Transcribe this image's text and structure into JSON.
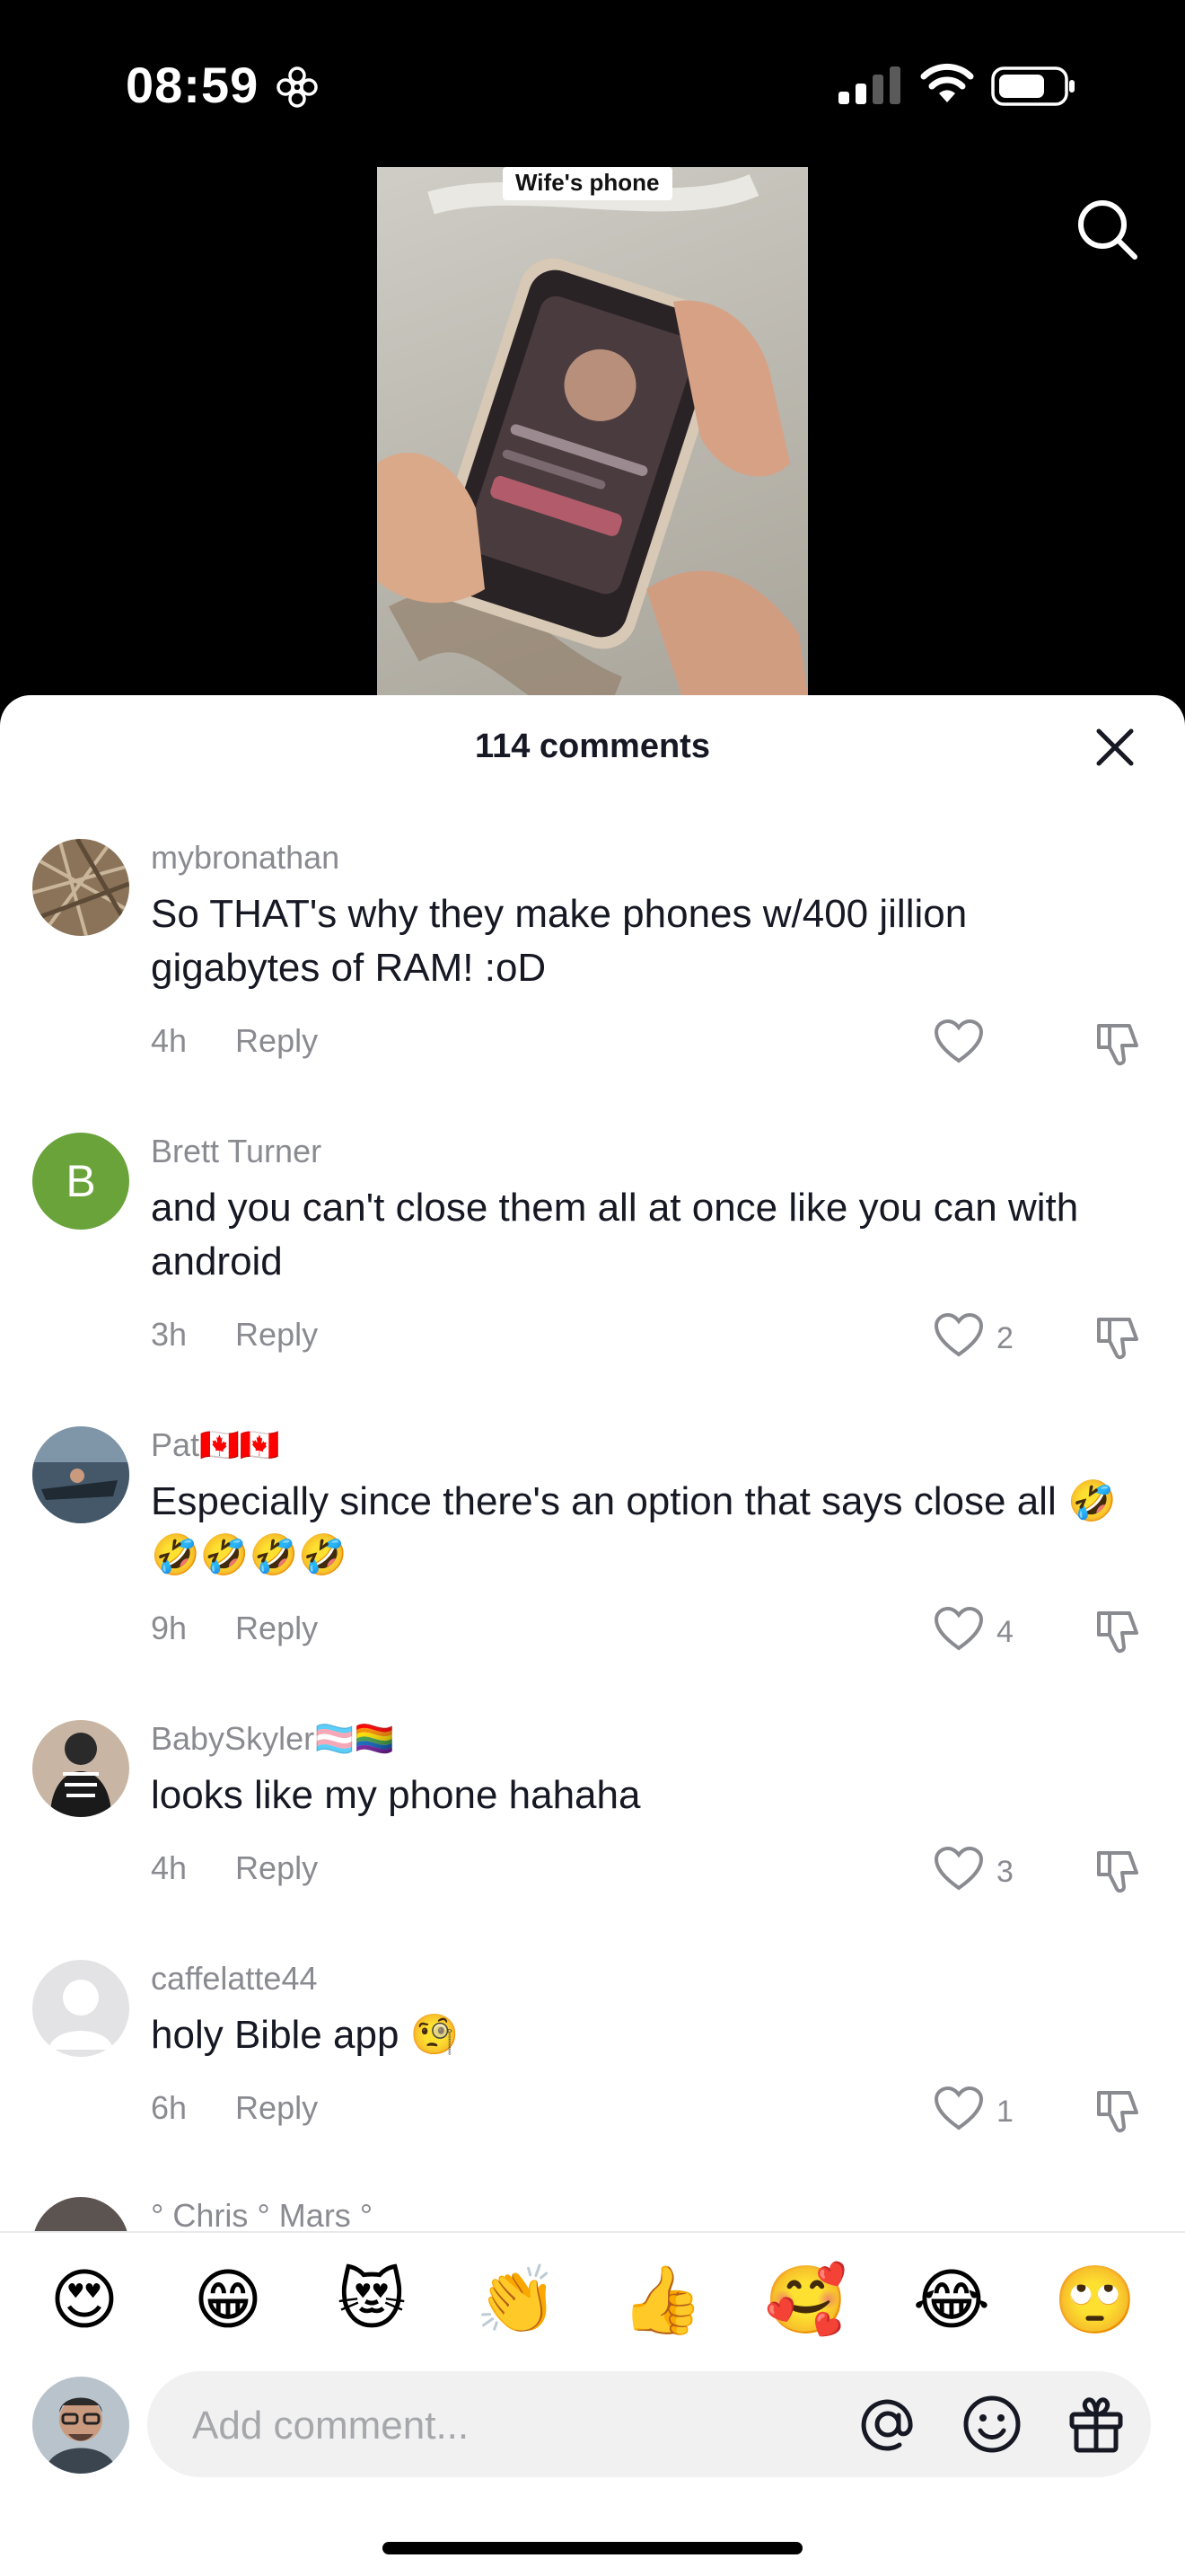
{
  "status": {
    "time": "08:59"
  },
  "video": {
    "caption": "Wife's phone"
  },
  "sheet": {
    "title": "114 comments"
  },
  "comments": [
    {
      "username": "mybronathan",
      "text": "So THAT's why they make phones w/400 jillion gigabytes of RAM! :oD",
      "age": "4h",
      "reply": "Reply",
      "likes": ""
    },
    {
      "username": "Brett Turner",
      "text": "and you can't close them all at once like you can with android",
      "age": "3h",
      "reply": "Reply",
      "likes": "2",
      "avatar_letter": "B"
    },
    {
      "username": "Pat🇨🇦🇨🇦",
      "text": "Especially since there's an option that says close all 🤣🤣🤣🤣🤣",
      "age": "9h",
      "reply": "Reply",
      "likes": "4"
    },
    {
      "username": "BabySkyler🏳️‍⚧️🏳️‍🌈",
      "text": "looks like my phone hahaha",
      "age": "4h",
      "reply": "Reply",
      "likes": "3"
    },
    {
      "username": "caffelatte44",
      "text": "holy Bible app 🧐",
      "age": "6h",
      "reply": "Reply",
      "likes": "1"
    },
    {
      "username": "° Chris ° Mars °"
    }
  ],
  "emojis": [
    "😍",
    "😁",
    "😻",
    "👏",
    "👍",
    "🥰",
    "😂",
    "🙄"
  ],
  "composer": {
    "placeholder": "Add comment..."
  },
  "icons": [
    "focus-flower-icon",
    "signal-icon",
    "wifi-icon",
    "battery-icon",
    "search-icon",
    "close-icon",
    "heart-icon",
    "thumbs-down-icon",
    "at-icon",
    "smiley-icon",
    "gift-icon"
  ],
  "colors": {
    "background": "#000000",
    "sheet": "#ffffff",
    "muted_text": "#8a8b91",
    "avatar_green": "#6aa33a"
  }
}
